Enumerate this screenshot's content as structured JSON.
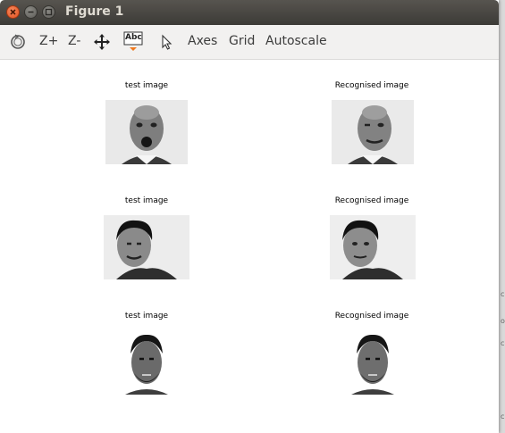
{
  "window": {
    "title": "Figure 1"
  },
  "toolbar": {
    "tools": [
      {
        "icon": "reset-view-icon"
      },
      {
        "label": "Z+"
      },
      {
        "label": "Z-"
      },
      {
        "icon": "pan-icon"
      },
      {
        "icon": "text-tool-icon",
        "label": "Abc"
      },
      {
        "icon": "pointer-icon"
      },
      {
        "label": "Axes"
      },
      {
        "label": "Grid"
      },
      {
        "label": "Autoscale"
      }
    ]
  },
  "figure": {
    "panels": [
      {
        "title": "test image"
      },
      {
        "title": "Recognised image"
      },
      {
        "title": "test image"
      },
      {
        "title": "Recognised image"
      },
      {
        "title": "test image"
      },
      {
        "title": "Recognised image"
      }
    ]
  },
  "colors": {
    "titlebar": "#3c3b37",
    "close": "#e95420",
    "toolbar": "#f2f1f0"
  }
}
